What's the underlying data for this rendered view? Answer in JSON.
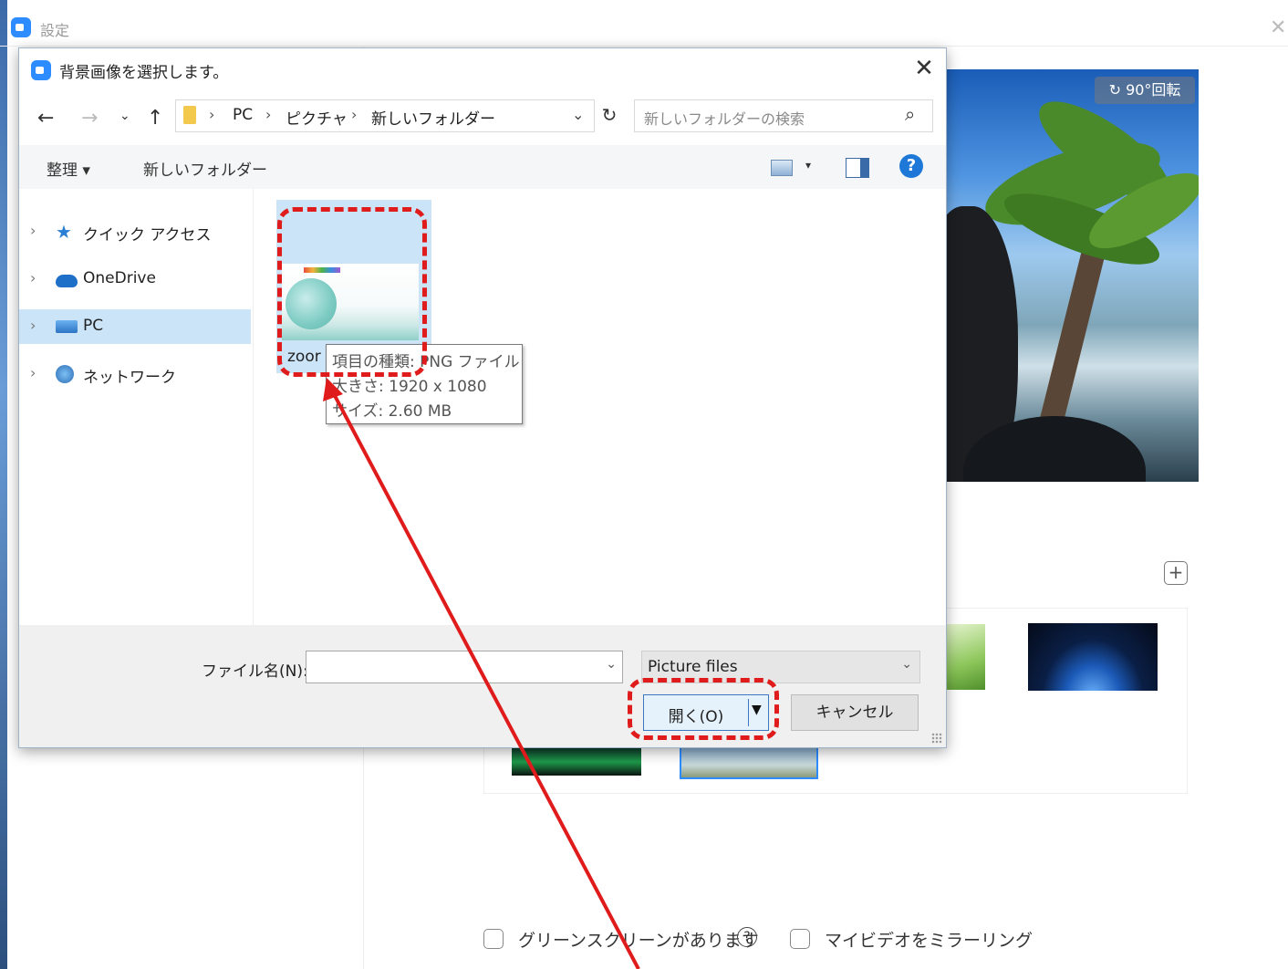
{
  "app": {
    "title": "設定"
  },
  "preview": {
    "rotate_label": "90°回転"
  },
  "options": {
    "green_screen_label": "グリーンスクリーンがあります",
    "mirror_label": "マイビデオをミラーリング"
  },
  "dialog": {
    "title": "背景画像を選択します。",
    "address": {
      "crumbs": [
        "PC",
        "ピクチャ",
        "新しいフォルダー"
      ]
    },
    "search_placeholder": "新しいフォルダーの検索",
    "toolbar": {
      "organize_label": "整理 ▾",
      "new_folder_label": "新しいフォルダー"
    },
    "nav_items": [
      {
        "label": "クイック アクセス",
        "icon": "star-icon"
      },
      {
        "label": "OneDrive",
        "icon": "cloud-icon"
      },
      {
        "label": "PC",
        "icon": "computer-icon",
        "selected": true
      },
      {
        "label": "ネットワーク",
        "icon": "network-icon"
      }
    ],
    "file": {
      "name_visible": "zoor",
      "tooltip": [
        "項目の種類: PNG ファイル",
        "大きさ: 1920 x 1080",
        "サイズ: 2.60 MB"
      ]
    },
    "filename_label": "ファイル名(N):",
    "filename_value": "",
    "filter_value": "Picture files",
    "open_label": "開く(O)",
    "cancel_label": "キャンセル"
  },
  "colors": {
    "accent": "#2d8cff",
    "annotation": "#e01b1b",
    "selection": "#cce4f7"
  }
}
